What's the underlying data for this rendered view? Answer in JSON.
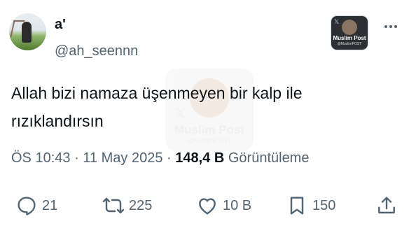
{
  "author": {
    "display_name": "a'",
    "handle": "@ah_seennn"
  },
  "logo": {
    "brand": "Muslim Post",
    "handle": "@MuslimPOST"
  },
  "watermark": {
    "brand": "Muslim Post",
    "handle": "@MuslimPOST"
  },
  "tweet": {
    "text_line1": "Allah bizi namaza üşenmeyen bir kalp ile",
    "text_line2": "rızıklandırsın"
  },
  "meta": {
    "time": "ÖS 10:43",
    "sep1": " · ",
    "date": "11 May 2025",
    "sep2": " · ",
    "views": "148,4 B",
    "views_label": " Görüntüleme"
  },
  "actions": {
    "replies": "21",
    "reposts": "225",
    "likes": "10 B",
    "bookmarks": "150"
  },
  "colors": {
    "text": "#0f1419",
    "secondary": "#536471",
    "background": "#ffffff"
  },
  "icons": [
    "reply-icon",
    "repost-icon",
    "like-icon",
    "bookmark-icon",
    "share-icon",
    "more-icon"
  ]
}
